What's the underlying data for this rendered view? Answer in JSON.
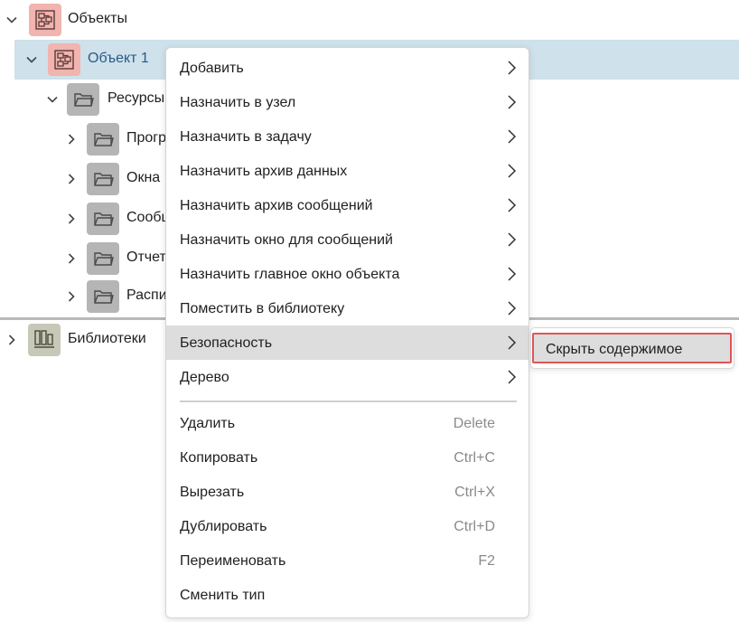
{
  "tree": {
    "root": {
      "label": "Объекты",
      "icon": "object-icon"
    },
    "object1": {
      "label": "Объект 1",
      "icon": "object-icon"
    },
    "resources": {
      "label": "Ресурсы",
      "icon": "folder-icon"
    },
    "children": [
      {
        "label": "Прогр"
      },
      {
        "label": "Окна"
      },
      {
        "label": "Сообщ"
      },
      {
        "label": "Отчет"
      },
      {
        "label": "Распи"
      }
    ],
    "libraries": {
      "label": "Библиотеки",
      "icon": "library-icon"
    }
  },
  "context_menu": {
    "items": [
      {
        "label": "Добавить",
        "submenu": true
      },
      {
        "label": "Назначить в узел",
        "submenu": true
      },
      {
        "label": "Назначить в задачу",
        "submenu": true
      },
      {
        "label": "Назначить архив данных",
        "submenu": true
      },
      {
        "label": "Назначить архив сообщений",
        "submenu": true
      },
      {
        "label": "Назначить окно для сообщений",
        "submenu": true
      },
      {
        "label": "Назначить главное окно объекта",
        "submenu": true
      },
      {
        "label": "Поместить в библиотеку",
        "submenu": true
      },
      {
        "label": "Безопасность",
        "submenu": true,
        "highlighted": true
      },
      {
        "label": "Дерево",
        "submenu": true
      }
    ],
    "actions": [
      {
        "label": "Удалить",
        "shortcut": "Delete"
      },
      {
        "label": "Копировать",
        "shortcut": "Ctrl+C"
      },
      {
        "label": "Вырезать",
        "shortcut": "Ctrl+X"
      },
      {
        "label": "Дублировать",
        "shortcut": "Ctrl+D"
      },
      {
        "label": "Переименовать",
        "shortcut": "F2"
      },
      {
        "label": "Сменить тип",
        "shortcut": ""
      }
    ]
  },
  "submenu": {
    "items": [
      {
        "label": "Скрыть содержимое"
      }
    ]
  },
  "colors": {
    "selected_row": "#cfe1ea",
    "object_icon_bg": "#f1b4ae",
    "folder_icon_bg": "#b5b5b5",
    "menu_hover": "#dddddd",
    "highlight_border": "#e05555"
  }
}
